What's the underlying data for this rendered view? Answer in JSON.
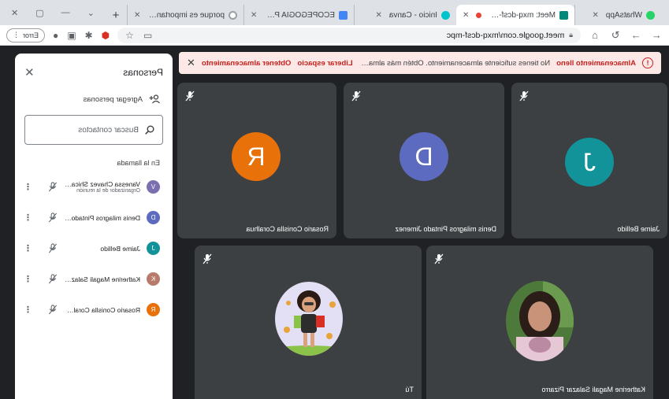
{
  "browser": {
    "tabs": [
      {
        "label": "WhatsApp",
        "fav_color": "#25d366"
      },
      {
        "label": "Meet: mxq-dcsf-mpc",
        "fav_color": "#00897b",
        "active": true,
        "recording": true
      },
      {
        "label": "Inicio - Canva",
        "fav_color": "#00c4cc"
      },
      {
        "label": "ECOPEGOGIA PARA UN MUNDO ...",
        "fav_color": "#4285f4"
      },
      {
        "label": "porque es importante reciclar pa...",
        "fav_color": "#9aa0a6"
      }
    ],
    "url": "meet.google.com/mxq-dcsf-mpc",
    "error_button": "Error"
  },
  "banner": {
    "title": "Almacenamiento lleno",
    "message": "No tienes suficiente almacenamiento. Obtén más almacenamiento o borra elemento...",
    "link_free": "Liberar espacio",
    "link_get": "Obtener almacenamiento"
  },
  "tiles": [
    {
      "name": "Jaime Bellido",
      "initial": "J",
      "color": "#12939a"
    },
    {
      "name": "Denis milagros Pintado Jimenez",
      "initial": "D",
      "color": "#5c6bc0"
    },
    {
      "name": "Rosario Conislla Coralhua",
      "initial": "R",
      "color": "#e8710a"
    },
    {
      "name": "Katherine Magali Salazar Pizarro"
    },
    {
      "name": "Tú"
    }
  ],
  "panel": {
    "title": "Personas",
    "add_people": "Agregar personas",
    "search_placeholder": "Buscar contactos",
    "section_label": "En la llamada",
    "people": [
      {
        "name": "Vanessa Chavez Shica (Tú)",
        "sub": "Organizador de la reunión",
        "color": "#7c6fb0",
        "initial": "V"
      },
      {
        "name": "Denis milagros Pintado Jim...",
        "sub": "",
        "color": "#5c6bc0",
        "initial": "D"
      },
      {
        "name": "Jaime Bellido",
        "sub": "",
        "color": "#12939a",
        "initial": "J"
      },
      {
        "name": "Katherine Magali Salazar Pi...",
        "sub": "",
        "color": "#b87a6a",
        "initial": "K"
      },
      {
        "name": "Rosario Conislla Coralhua",
        "sub": "",
        "color": "#e8710a",
        "initial": "R"
      }
    ]
  },
  "icons": {
    "muted_mic": "mic-off-icon",
    "close": "close-icon",
    "search": "search-icon",
    "add_person": "person-add-icon",
    "more": "more-vert-icon",
    "warning": "warning-icon"
  }
}
